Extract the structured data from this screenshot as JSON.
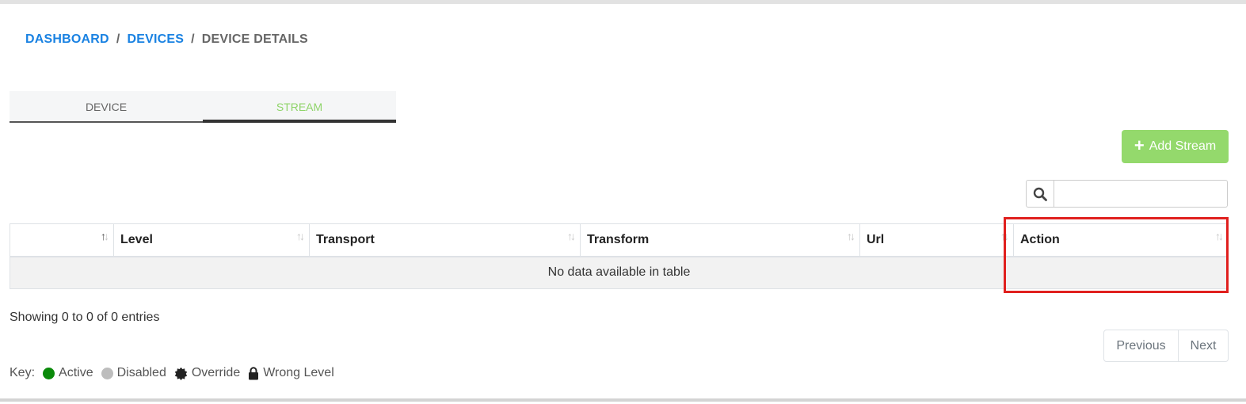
{
  "breadcrumb": {
    "items": [
      "DASHBOARD",
      "DEVICES"
    ],
    "separator": "/",
    "current": "DEVICE DETAILS"
  },
  "tabs": [
    {
      "label": "DEVICE",
      "active": false
    },
    {
      "label": "STREAM",
      "active": true
    }
  ],
  "toolbar": {
    "add_icon": "+",
    "add_label": "Add Stream",
    "search_icon": "search-icon",
    "search_value": ""
  },
  "table": {
    "columns": [
      "",
      "Level",
      "Transport",
      "Transform",
      "Url",
      "Action"
    ],
    "sort_icon": "↑↓",
    "empty_message": "No data available in table"
  },
  "info": "Showing 0 to 0 of 0 entries",
  "pagination": {
    "previous": "Previous",
    "next": "Next"
  },
  "legend": {
    "label": "Key:",
    "items": [
      {
        "label": "Active",
        "icon": "green-dot",
        "color": "#0a8a0a"
      },
      {
        "label": "Disabled",
        "icon": "grey-dot",
        "color": "#bdbdbd"
      },
      {
        "label": "Override",
        "icon": "badge-icon",
        "color": "#222222"
      },
      {
        "label": "Wrong Level",
        "icon": "lock-icon",
        "color": "#222222"
      }
    ]
  },
  "colors": {
    "link": "#1a82e2",
    "accent_green": "#94d96c",
    "highlight_red": "#e0201e"
  }
}
